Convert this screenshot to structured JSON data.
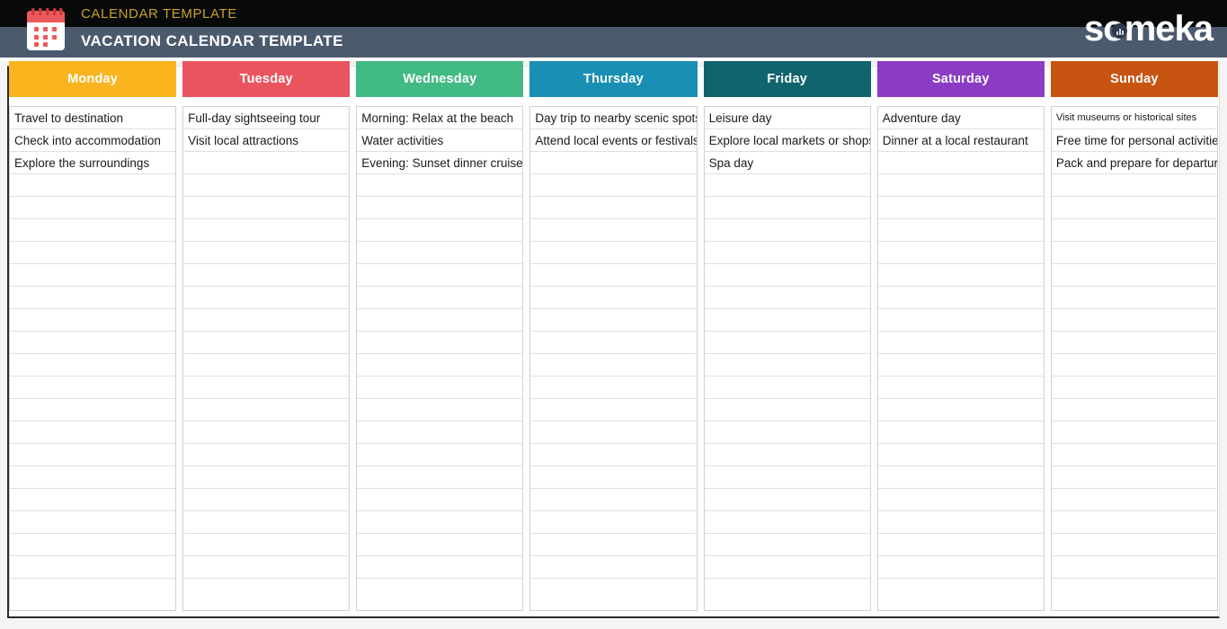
{
  "header": {
    "subtitle": "CALENDAR TEMPLATE",
    "title": "VACATION CALENDAR TEMPLATE",
    "brand": "someka",
    "icon": "calendar-icon",
    "colors": {
      "top_band": "#08090b",
      "bottom_band": "#4c5a6e",
      "subtitle_text": "#c9a227",
      "title_text": "#ffffff"
    }
  },
  "calendar": {
    "rows_per_column": 22,
    "columns": [
      {
        "day": "Monday",
        "color": "#f9b41e",
        "entries": [
          "Travel to destination",
          "Check into accommodation",
          "Explore the surroundings"
        ]
      },
      {
        "day": "Tuesday",
        "color": "#e9555f",
        "entries": [
          "Full-day sightseeing tour",
          "Visit local attractions"
        ]
      },
      {
        "day": "Wednesday",
        "color": "#42ba83",
        "entries": [
          "Morning: Relax at the beach",
          "Water activities",
          "Evening: Sunset dinner cruise"
        ]
      },
      {
        "day": "Thursday",
        "color": "#1a8fb4",
        "entries": [
          "Day trip to nearby scenic spotss",
          "Attend local events or festivals"
        ]
      },
      {
        "day": "Friday",
        "color": "#10646e",
        "entries": [
          "Leisure day",
          "Explore local markets or shops",
          "Spa day"
        ]
      },
      {
        "day": "Saturday",
        "color": "#8b3bc4",
        "entries": [
          "Adventure day",
          "Dinner at a local restaurant"
        ]
      },
      {
        "day": "Sunday",
        "color": "#c75511",
        "entries": [
          "Visit museums or historical sites",
          "Free time for personal activities",
          "Pack and prepare for departure"
        ]
      }
    ]
  }
}
